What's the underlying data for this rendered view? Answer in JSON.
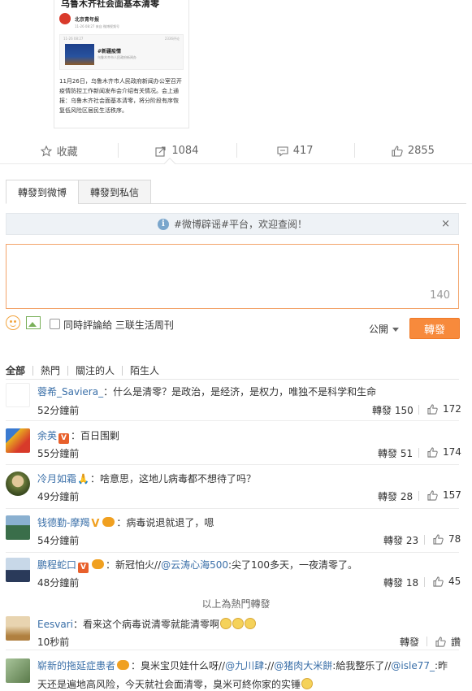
{
  "preview": {
    "title": "乌鲁木齐社会面基本清零",
    "account": "北京青年报",
    "account_sub": "11-26 08:27 来自 微博视频号",
    "card_top_left": "11-26 08:27",
    "card_top_right": "2336评论",
    "card_tag": "#新疆疫情",
    "card_tag_sub": "乌鲁木齐市人民政府新闻办",
    "body": "11月26日，乌鲁木齐市人民政府新闻办公室召开疫情防控工作新闻发布会介绍有关情况。会上通报：乌鲁木齐社会面基本清零，将分阶段有序恢复低风险区居民生活秩序。"
  },
  "actions": {
    "favorite": "收藏",
    "forward_count": "1084",
    "comment_count": "417",
    "like_count": "2855"
  },
  "tabs": [
    "轉發到微博",
    "轉發到私信"
  ],
  "notice": {
    "text": "#微博辟谣#平台，欢迎查阅！",
    "close": "×"
  },
  "composer": {
    "value": "",
    "counter": "140"
  },
  "toolbar": {
    "checkbox_label": "同時評論給 三联生活周刊",
    "visibility": "公開",
    "forward_button": "轉發"
  },
  "filters": [
    "全部",
    "熱門",
    "關注的人",
    "陌生人"
  ],
  "comments": [
    {
      "user": "蓉希_Saviera_",
      "badge": "",
      "text": "：什么是清零？是政治，是经济，是权力，唯独不是科学和生命",
      "time": "52分鐘前",
      "forward": "轉發 150",
      "likes": "172",
      "avatar_color": "#ffffff"
    },
    {
      "user": "余英",
      "badge": "V",
      "text": "：百日围剿",
      "time": "55分鐘前",
      "forward": "轉發 51",
      "likes": "174",
      "avatar_color": "#e8b020"
    },
    {
      "user": "冷月如霜",
      "badge": "",
      "text": "：啥意思，这地儿病毒都不想待了吗？",
      "time": "49分鐘前",
      "forward": "轉發 28",
      "likes": "157",
      "avatar_color": "#9a8a5a"
    },
    {
      "user": "钱德勤-摩羯",
      "badge": "V",
      "text": "：病毒说退就退了，嗯",
      "time": "54分鐘前",
      "forward": "轉發 23",
      "likes": "78",
      "avatar_color": "#3a6e4a"
    },
    {
      "user": "鹏程蛇口",
      "badge": "V",
      "text_before": "：新冠怕火//",
      "mention": "@云涛心海500",
      "text_after": ":尖了100多天，一夜清零了。",
      "time": "48分鐘前",
      "forward": "轉發 18",
      "likes": "45",
      "avatar_color": "#8aa6c4"
    }
  ],
  "hot_divider": "以上為熱門轉發",
  "more_comments": [
    {
      "user": "Eesvari",
      "text": "：看来这个病毒说清零就能清零啊",
      "time": "10秒前",
      "forward": "轉發",
      "likes": "讚",
      "avatar_color": "#c9a46a"
    },
    {
      "user": "崭新的拖延症患者",
      "text_before": "：臭米宝贝娃什么呀//",
      "mention1": "@九川肆",
      "text_mid1": "://",
      "mention2": "@猪肉大米餅",
      "text_mid2": ":給我整乐了//",
      "mention3": "@isle77_",
      "text_after": ":昨",
      "line2": "天还是遍地高风险，今天就社会面清零，臭米可終你家的实锤",
      "avatar_color": "#a8c49a"
    }
  ]
}
